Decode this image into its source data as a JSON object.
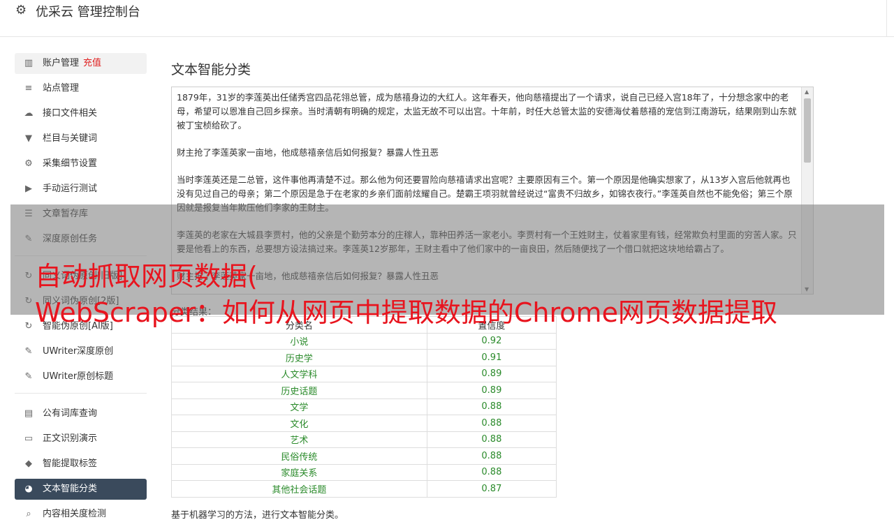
{
  "header": {
    "title": "优采云 管理控制台"
  },
  "sidebar": {
    "group1": [
      {
        "icon": "bar-chart-icon",
        "glyph": "▥",
        "label": "账户管理",
        "extra": "充值",
        "state": "hover"
      },
      {
        "icon": "server-icon",
        "glyph": "≡",
        "label": "站点管理"
      },
      {
        "icon": "cloud-upload-icon",
        "glyph": "☁",
        "label": "接口文件相关"
      },
      {
        "icon": "filter-icon",
        "glyph": "▼",
        "label": "栏目与关键词"
      },
      {
        "icon": "cogs-icon",
        "glyph": "⚙",
        "label": "采集细节设置"
      },
      {
        "icon": "play-circle-icon",
        "glyph": "▶",
        "label": "手动运行测试"
      },
      {
        "icon": "database-icon",
        "glyph": "☰",
        "label": "文章暂存库"
      },
      {
        "icon": "edit-icon",
        "glyph": "✎",
        "label": "深度原创任务"
      }
    ],
    "group2": [
      {
        "icon": "refresh-icon",
        "glyph": "↻",
        "label": "同义词伪原创[旧版]"
      },
      {
        "icon": "refresh-icon",
        "glyph": "↻",
        "label": "同义词伪原创[2版]"
      },
      {
        "icon": "refresh-icon",
        "glyph": "↻",
        "label": "智能伪原创[AI版]"
      },
      {
        "icon": "edit-icon",
        "glyph": "✎",
        "label": "UWriter深度原创"
      },
      {
        "icon": "edit-icon",
        "glyph": "✎",
        "label": "UWriter原创标题"
      }
    ],
    "group3": [
      {
        "icon": "book-icon",
        "glyph": "▤",
        "label": "公有词库查询"
      },
      {
        "icon": "monitor-icon",
        "glyph": "▭",
        "label": "正文识别演示"
      },
      {
        "icon": "tag-icon",
        "glyph": "◆",
        "label": "智能提取标签"
      },
      {
        "icon": "pie-chart-icon",
        "glyph": "◕",
        "label": "文本智能分类",
        "state": "active"
      },
      {
        "icon": "search-icon",
        "glyph": "⌕",
        "label": "内容相关度检测"
      }
    ]
  },
  "main": {
    "title": "文本智能分类",
    "paragraphs": [
      "1879年，31岁的李莲英出任储秀宫四品花翎总管，成为慈禧身边的大红人。这年春天，他向慈禧提出了一个请求，说自己已经入宫18年了，十分想念家中的老母，希望可以恩准自己回乡探亲。当时清朝有明确的规定，太监无故不可以出宫。十年前，时任大总管太监的安德海仗着慈禧的宠信到江南游玩，结果刚到山东就被丁宝桢给砍了。",
      "财主抢了李莲英家一亩地，他成慈禧亲信后如何报复？暴露人性丑恶",
      "当时李莲英还是二总管，这件事他再清楚不过。那么他为何还要冒险向慈禧请求出宫呢？主要原因有三个。第一个原因是他确实想家了，从13岁入宫后他就再也没有见过自己的母亲；第二个原因是急于在老家的乡亲们面前炫耀自己。楚霸王项羽就曾经说过“富贵不归故乡，如锦衣夜行。”李莲英自然也不能免俗；第三个原因就是报复当年欺压他们李家的王财主。",
      "李莲英的老家在大城县李贾村，他的父亲是个勤劳本分的庄稼人，靠种田养活一家老小。李贾村有一个王姓财主，仗着家里有钱，经常欺负村里面的穷苦人家。只要是他看上的东西，总要想方设法搞过来。李莲英12岁那年，王财主看中了他们家中的一亩良田，然后随便找了一个借口就把这块地给霸占了。",
      "财主抢了李莲英家一亩地，他成慈禧亲信后如何报复？暴露人性丑恶"
    ],
    "result_label": "分类结果：",
    "table": {
      "headers": [
        "分类名",
        "置信度"
      ],
      "rows": [
        [
          "小说",
          "0.92"
        ],
        [
          "历史学",
          "0.91"
        ],
        [
          "人文学科",
          "0.89"
        ],
        [
          "历史话题",
          "0.89"
        ],
        [
          "文学",
          "0.88"
        ],
        [
          "文化",
          "0.88"
        ],
        [
          "艺术",
          "0.88"
        ],
        [
          "民俗传统",
          "0.88"
        ],
        [
          "家庭关系",
          "0.88"
        ],
        [
          "其他社会话题",
          "0.87"
        ]
      ]
    },
    "description": "基于机器学习的方法，进行文本智能分类。"
  },
  "overlay": {
    "text": "自动抓取网页数据(\nWebScraper：如何从网页中提取数据的Chrome网页数据提取"
  },
  "colors": {
    "active_bg": "#3a4a5c",
    "result_green": "#2a8a2a",
    "overlay_text": "#e8141e",
    "recharge_red": "#e02020"
  }
}
